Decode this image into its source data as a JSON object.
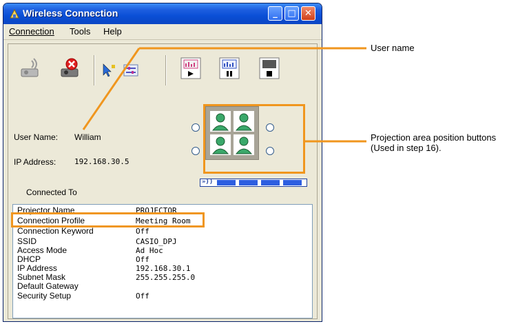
{
  "window": {
    "title": "Wireless Connection",
    "min_glyph": "_",
    "max_glyph": "□",
    "close_glyph": "✕"
  },
  "menu": [
    "Connection",
    "Tools",
    "Help"
  ],
  "toolbar": {
    "icons": [
      "connect-projector-icon",
      "disconnect-icon",
      "help-arrow-icon",
      "settings-icon",
      "play-icon",
      "pause-icon",
      "stop-icon"
    ]
  },
  "info": {
    "user_name_label": "User Name:",
    "user_name": "William",
    "ip_label": "IP Address:",
    "ip": "192.168.30.5",
    "connected_to": "Connected To"
  },
  "signal": {
    "glyph": "»))",
    "level_fraction": 1.0,
    "color": "#2d5ee0"
  },
  "details": [
    {
      "k": "Projector Name",
      "v": "PROJECTOR"
    },
    {
      "k": "Connection Profile",
      "v": "Meeting Room"
    },
    {
      "k": "Connection Keyword",
      "v": "Off"
    },
    {
      "k": "SSID",
      "v": "CASIO_DPJ"
    },
    {
      "k": "Access Mode",
      "v": "Ad Hoc"
    },
    {
      "k": "DHCP",
      "v": "Off"
    },
    {
      "k": "IP Address",
      "v": "192.168.30.1"
    },
    {
      "k": "Subnet Mask",
      "v": "255.255.255.0"
    },
    {
      "k": "Default Gateway",
      "v": ""
    },
    {
      "k": "Security Setup",
      "v": "Off"
    }
  ],
  "callouts": {
    "user_name": "User name",
    "position_line1": "Projection area position buttons",
    "position_line2": "(Used in step 16).",
    "color": "#f0961e"
  }
}
